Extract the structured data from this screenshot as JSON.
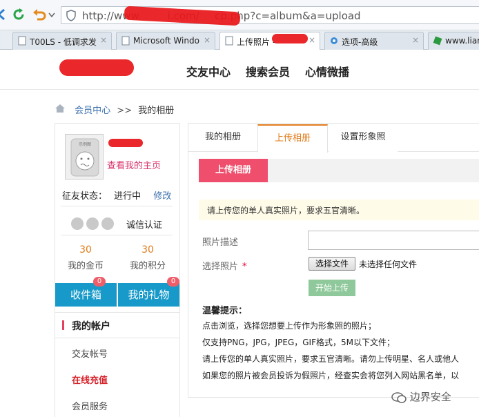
{
  "browser": {
    "url": "http://www.     i.com/   cp.php?c=album&a=upload",
    "tabs": [
      {
        "label": "T00LS - 低调求发"
      },
      {
        "label": "Microsoft Windo"
      },
      {
        "label": "上传照片 -"
      },
      {
        "label": "选项-高级"
      },
      {
        "label": "www.liar"
      }
    ],
    "close_glyph": "×"
  },
  "site": {
    "nav": [
      "交友中心",
      "搜索会员",
      "心情微播"
    ],
    "breadcrumb": {
      "link": "会员中心",
      "separator": ">>",
      "current": "我的相册"
    }
  },
  "profile": {
    "avatar_caption": "示例图",
    "homepage_link": "查看我的主页",
    "status_label": "征友状态：",
    "status_value": "进行中",
    "edit_link": "修改",
    "verify_label": "诚信认证",
    "stats": [
      {
        "value": "30",
        "label": "我的金币"
      },
      {
        "value": "30",
        "label": "我的积分"
      }
    ],
    "actions": [
      {
        "label": "收件箱",
        "badge": "0"
      },
      {
        "label": "我的礼物",
        "badge": "0"
      }
    ]
  },
  "account_menu": {
    "title": "我的帐户",
    "items": [
      {
        "label": "交友帐号"
      },
      {
        "label": "在线充值"
      },
      {
        "label": "会员服务"
      }
    ]
  },
  "content": {
    "tabs": [
      "我的相册",
      "上传相册",
      "设置形象照"
    ],
    "upload_heading": "上传相册",
    "notice": "请上传您的单人真实照片，要求五官清晰。",
    "desc_label": "照片描述",
    "file_label": "选择照片",
    "required_mark": "*",
    "file_button": "选择文件",
    "file_status": "未选择任何文件",
    "start_button": "开始上传",
    "tips_title": "温馨提示：",
    "tips": [
      "点击浏览，选择您想要上传作为形象照的照片；",
      "仅支持PNG，JPG，JPEG，GIF格式，5M以下文件；",
      "请上传您的单人真实照片，要求五官清晰。请勿上传明星、名人或他人",
      "如果您的照片被会员投诉为假照片，经查实会将您列入网站黑名单，以"
    ]
  },
  "watermark": "边界安全",
  "colors": {
    "accent_pink": "#ef4e6d",
    "blue_button": "#179ac9",
    "orange": "#e07b1a",
    "link_blue": "#3b6fae"
  }
}
